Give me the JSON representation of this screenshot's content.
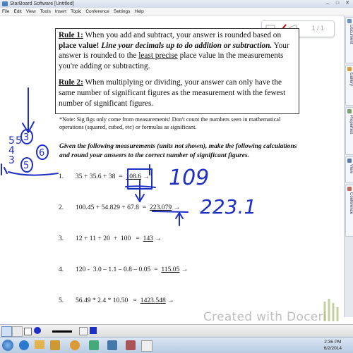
{
  "window": {
    "title": "StarBoard Software [Untitled]"
  },
  "menu": [
    "File",
    "Edit",
    "View",
    "Tools",
    "Insert",
    "Topic",
    "Conference",
    "Settings",
    "Help"
  ],
  "dock_tabs": [
    "Document",
    "Gallery",
    "Properties",
    "View",
    "Conference"
  ],
  "page_nav": {
    "label": "1 / 1"
  },
  "rules": {
    "rule1_heading": "Rule 1:",
    "rule1_a": " When you add and subtract, your answer is rounded based on ",
    "rule1_bold": "place value!",
    "rule1_italic": " Line your decimals up to do addition or subtraction.",
    "rule1_b": " Your answer is rounded to the ",
    "rule1_underline": "least precise",
    "rule1_c": " place value in the measurements you're adding or subtracting.",
    "rule2_heading": "Rule 2:",
    "rule2_text": " When multiplying or dividing, your answer can only have the same number of significant figures as the measurement with the fewest number of significant figures."
  },
  "note": "*Note: Sig figs only come from measurements! Don't count the numbers seen in mathematical operations (squared, cubed, etc) or formulas as significant.",
  "instructions": "Given the following measurements (units not shown), make the following calculations and round your answers to the correct number of significant figures.",
  "problems": [
    {
      "num": "1.",
      "expr": "35 + 35.6 + 38  =  ",
      "answer": "108.6"
    },
    {
      "num": "2.",
      "expr": "100.45 + 54.829 + 67.8  =  ",
      "answer": "223.079"
    },
    {
      "num": "3.",
      "expr": "12 + 11 + 20  +  100   =  ",
      "answer": "143"
    },
    {
      "num": "4.",
      "expr": "120 -  3.0 – 1.1 – 0.8 – 0.05  =  ",
      "answer": "115.05"
    },
    {
      "num": "5.",
      "expr": "56.49 * 2.4 * 10.50   =  ",
      "answer": "1423.548"
    }
  ],
  "handwriting": {
    "ans1": "109",
    "ans2": "223.1",
    "left_digits": [
      "5",
      "4",
      "3",
      "5"
    ],
    "left_circled": [
      "3",
      "5"
    ],
    "left_extra": "6"
  },
  "watermark": "Created with Doceri",
  "clock": {
    "time": "2:36 PM",
    "date": "6/2/2014"
  },
  "colors": {
    "ink": "#1e2fc4",
    "accent": "#4a7fc1"
  }
}
